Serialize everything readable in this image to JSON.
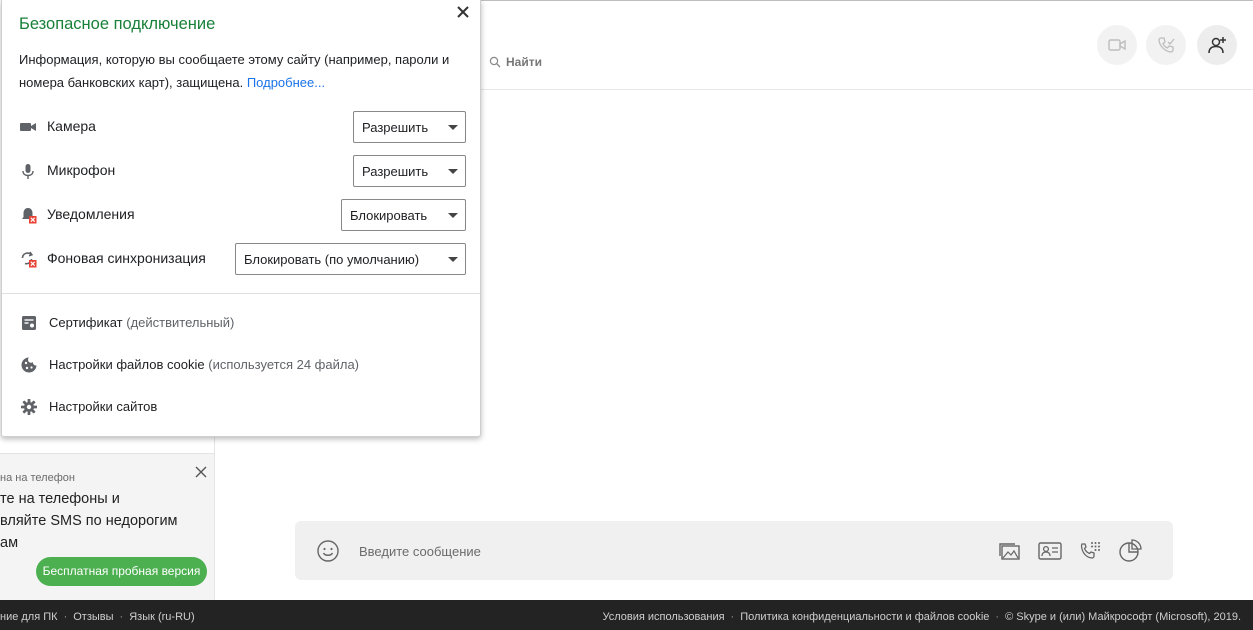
{
  "popup": {
    "title": "Безопасное подключение",
    "info_text": "Информация, которую вы сообщаете этому сайту (например, пароли и номера банковских карт), защищена.",
    "more_link": "Подробнее...",
    "permissions": [
      {
        "label": "Камера",
        "value": "Разрешить",
        "icon": "camera-icon"
      },
      {
        "label": "Микрофон",
        "value": "Разрешить",
        "icon": "microphone-icon"
      },
      {
        "label": "Уведомления",
        "value": "Блокировать",
        "icon": "notifications-blocked-icon"
      },
      {
        "label": "Фоновая синхронизация",
        "value": "Блокировать (по умолчанию)",
        "icon": "sync-blocked-icon"
      }
    ],
    "links": [
      {
        "label": "Сертификат",
        "note": "(действительный)",
        "icon": "certificate-icon"
      },
      {
        "label": "Настройки файлов cookie",
        "note": "(используется 24 файла)",
        "icon": "cookie-icon"
      },
      {
        "label": "Настройки сайтов",
        "note": "",
        "icon": "gear-icon"
      }
    ],
    "colors": {
      "title": "#188038",
      "link": "#1a73e8"
    }
  },
  "header": {
    "search_label": "Найти",
    "actions": [
      "video-call-icon",
      "audio-call-icon",
      "add-contact-icon"
    ]
  },
  "promo": {
    "subtitle": "на на телефон",
    "lines": [
      "те на телефоны и",
      "вляйте SMS по недорогим",
      "ам"
    ],
    "trial_button": "Бесплатная пробная версия",
    "accent": "#4caf50"
  },
  "composer": {
    "placeholder": "Введите сообщение",
    "icons": [
      "emoji-icon",
      "image-icon",
      "contact-card-icon",
      "dialpad-icon",
      "poll-icon"
    ]
  },
  "footer": {
    "left": [
      "ние для ПК",
      "Отзывы",
      "Язык (ru-RU)"
    ],
    "right": [
      "Условия использования",
      "Политика конфиденциальности и файлов cookie",
      "© Skype и (или) Майкрософт (Microsoft), 2019."
    ],
    "separator": "·"
  }
}
